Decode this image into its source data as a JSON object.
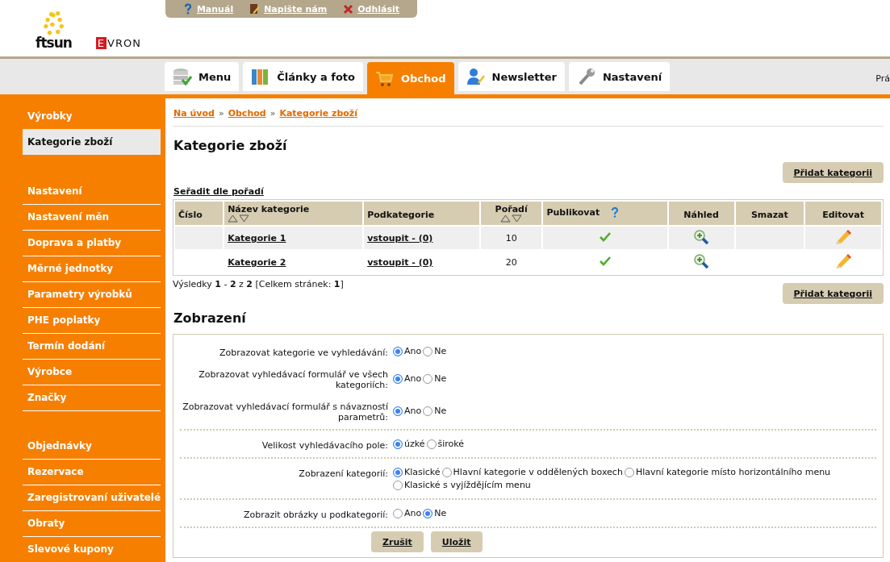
{
  "top_links": [
    {
      "kind": "help",
      "label": "Manuál"
    },
    {
      "kind": "write",
      "label": "Napište nám"
    },
    {
      "kind": "logout",
      "label": "Odhlásit"
    }
  ],
  "logos": {
    "primary": "ftsun",
    "secondary_initial": "E",
    "secondary_rest": "VRON"
  },
  "tabs": [
    {
      "kind": "menu",
      "label": "Menu",
      "selected": false
    },
    {
      "kind": "folders",
      "label": "Články a foto",
      "selected": false
    },
    {
      "kind": "cart",
      "label": "Obchod",
      "selected": true
    },
    {
      "kind": "user",
      "label": "Newsletter",
      "selected": false
    },
    {
      "kind": "tools",
      "label": "Nastavení",
      "selected": false
    }
  ],
  "tabbar_right_text": "Prá",
  "sidebar": {
    "groups": [
      [
        {
          "label": "Výrobky",
          "selected": false
        },
        {
          "label": "Kategorie zboží",
          "selected": true
        }
      ],
      [
        {
          "label": "Nastavení",
          "selected": false
        },
        {
          "label": "Nastavení měn",
          "selected": false
        },
        {
          "label": "Doprava a platby",
          "selected": false
        },
        {
          "label": "Měrné jednotky",
          "selected": false
        },
        {
          "label": "Parametry výrobků",
          "selected": false
        },
        {
          "label": "PHE poplatky",
          "selected": false
        },
        {
          "label": "Termín dodání",
          "selected": false
        },
        {
          "label": "Výrobce",
          "selected": false
        },
        {
          "label": "Značky",
          "selected": false
        }
      ],
      [
        {
          "label": "Objednávky",
          "selected": false
        },
        {
          "label": "Rezervace",
          "selected": false
        },
        {
          "label": "Zaregistrovaní uživatelé",
          "selected": false
        },
        {
          "label": "Obraty",
          "selected": false
        },
        {
          "label": "Slevové kupony",
          "selected": false
        }
      ]
    ]
  },
  "breadcrumb": [
    "Na úvod",
    "Obchod",
    "Kategorie zboží"
  ],
  "breadcrumb_separator": "»",
  "title": "Kategorie zboží",
  "add_button": "Přidat kategorii",
  "sort_link": "Seřadit dle pořadí",
  "table": {
    "columns": [
      {
        "label": "Číslo",
        "kind": "plain"
      },
      {
        "label": "Název kategorie",
        "kind": "sortable"
      },
      {
        "label": "Podkategorie",
        "kind": "plain"
      },
      {
        "label": "Pořadí",
        "kind": "sortable"
      },
      {
        "label": "Publikovat",
        "kind": "help"
      },
      {
        "label": "Náhled",
        "kind": "plain"
      },
      {
        "label": "Smazat",
        "kind": "plain"
      },
      {
        "label": "Editovat",
        "kind": "plain"
      }
    ],
    "rows": [
      {
        "name": "Kategorie 1",
        "subcategories": "vstoupit - (0)",
        "order": "10",
        "published": true
      },
      {
        "name": "Kategorie 2",
        "subcategories": "vstoupit - (0)",
        "order": "20",
        "published": true
      }
    ]
  },
  "pagination": "Výsledky **1** - **2** z **2** [Celkem stránek: **1**]",
  "add_button_bottom": "Přidat kategorii",
  "section_title": "Zobrazení",
  "form_sections": [
    [
      {
        "label": "Zobrazovat kategorie ve vyhledávání:",
        "options": [
          {
            "label": "Ano",
            "selected": true
          },
          {
            "label": "Ne",
            "selected": false
          }
        ]
      },
      {
        "label": "Zobrazovat vyhledávací formulář ve všech kategoriích:",
        "options": [
          {
            "label": "Ano",
            "selected": true
          },
          {
            "label": "Ne",
            "selected": false
          }
        ]
      },
      {
        "label": "Zobrazovat vyhledávací formulář s návazností parametrů:",
        "options": [
          {
            "label": "Ano",
            "selected": true
          },
          {
            "label": "Ne",
            "selected": false
          }
        ]
      }
    ],
    [
      {
        "label": "Velikost vyhledávacího pole:",
        "options": [
          {
            "label": "úzké",
            "selected": true
          },
          {
            "label": "široké",
            "selected": false
          }
        ]
      }
    ],
    [
      {
        "label": "Zobrazení kategorií:",
        "options": [
          {
            "label": "Klasické",
            "selected": true
          },
          {
            "label": "Hlavní kategorie v oddělených boxech",
            "selected": false
          },
          {
            "label": "Hlavní kategorie místo horizontálního menu",
            "selected": false
          },
          {
            "label": "Klasické s vyjíždějícím menu",
            "selected": false
          }
        ]
      }
    ],
    [
      {
        "label": "Zobrazit obrázky u podkategorií:",
        "options": [
          {
            "label": "Ano",
            "selected": false
          },
          {
            "label": "Ne",
            "selected": true
          }
        ]
      }
    ]
  ],
  "form_buttons": [
    "Zrušit",
    "Uložit"
  ]
}
